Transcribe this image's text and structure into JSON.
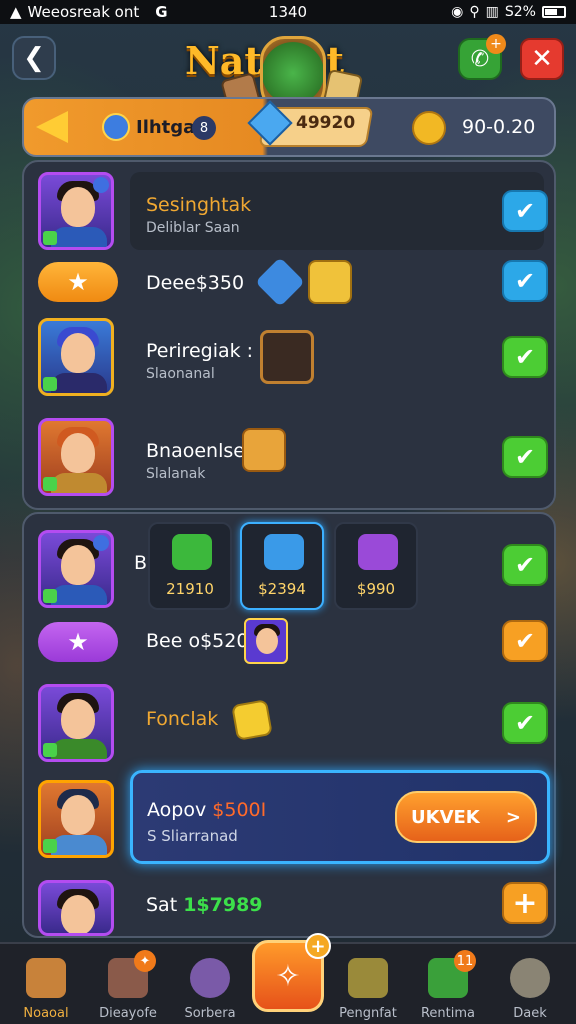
{
  "status_bar": {
    "carrier": "Weeosreak ont",
    "g_label": "G",
    "time": "1340",
    "battery_text": "S2%"
  },
  "header": {
    "back_icon": "back-arrow-icon",
    "title": "Natoiat",
    "friend_badge": "+",
    "close_icon": "close-icon"
  },
  "resources": {
    "player_name": "Ilhtgal",
    "player_level": "8",
    "gems_value": "49920",
    "gold_value": "90-0.20"
  },
  "panel_1": {
    "rows": [
      {
        "title": "Sesinghtak",
        "subtitle": "Deliblar Saan",
        "check": "blue"
      },
      {
        "title": "Deee$350",
        "check": "blue"
      },
      {
        "title": "Periregiak :",
        "subtitle": "Slaonanal",
        "check": "green"
      },
      {
        "title": "Bnaoenlse",
        "subtitle": "Slalanak",
        "check": "green"
      }
    ]
  },
  "panel_2": {
    "row1_letter": "B",
    "rewards": [
      {
        "value": "21910"
      },
      {
        "value": "$2394"
      },
      {
        "value": "$990"
      }
    ],
    "row2_title": "Bee o$520",
    "row3_title": "Fonclak",
    "offer": {
      "title": "Aopov",
      "price": "$500I",
      "subtitle": "S Sliarranad",
      "button_label": "UKVEK",
      "button_chevron": ">"
    },
    "row5_prefix": "Sat",
    "row5_price": "1$7989"
  },
  "bottom_nav": [
    {
      "label": "Noaoal"
    },
    {
      "label": "Dieayofe"
    },
    {
      "label": "Sorbera"
    },
    {
      "label": ""
    },
    {
      "label": "Pengnfat"
    },
    {
      "label": "Rentima",
      "badge": "11"
    },
    {
      "label": "Daek"
    }
  ],
  "colors": {
    "accent_orange": "#f7a023",
    "check_green": "#4ccd34",
    "check_blue": "#2ca8e8",
    "title_gold": "#ffb928"
  }
}
